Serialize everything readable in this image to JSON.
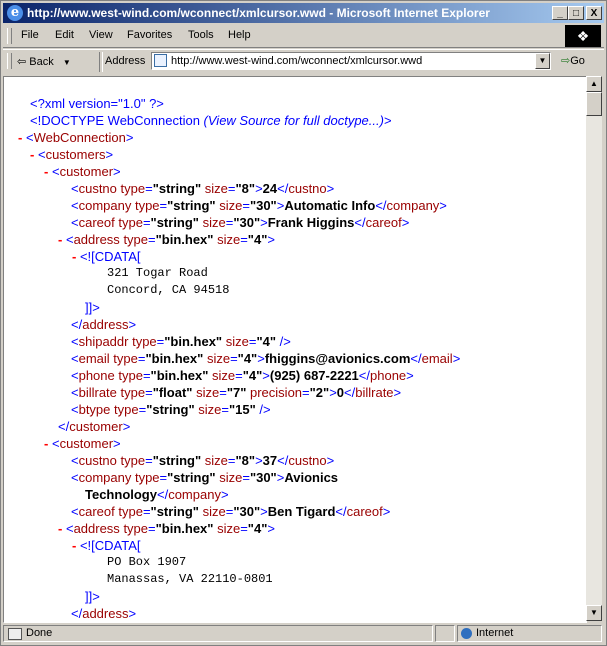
{
  "window": {
    "title": "http://www.west-wind.com/wconnect/xmlcursor.wwd - Microsoft Internet Explorer",
    "minimize": "_",
    "maximize": "□",
    "close": "X"
  },
  "menu": [
    "File",
    "Edit",
    "View",
    "Favorites",
    "Tools",
    "Help"
  ],
  "toolbar": {
    "back_label": "Back",
    "address_label": "Address",
    "address_value": "http://www.west-wind.com/wconnect/xmlcursor.wwd",
    "go_label": "Go"
  },
  "xml": {
    "pi": "<?xml version=\"1.0\" ?>",
    "doctype": "<!DOCTYPE WebConnection",
    "doctype_note": "(View Source for full doctype...)",
    "doctype_end": ">",
    "root": "WebConnection",
    "customers": "customers",
    "customer": "customer",
    "c1": {
      "custno": "24",
      "company": "Automatic Info",
      "careof": "Frank Higgins",
      "address_line1": "321 Togar Road",
      "address_line2": "Concord, CA 94518",
      "email": "fhiggins@avionics.com",
      "phone": "(925) 687-2221",
      "billrate": "0"
    },
    "c2": {
      "custno": "37",
      "company_a": "Avionics",
      "company_b": "Technology",
      "careof": "Ben Tigard",
      "address_line1": "PO Box 1907",
      "address_line2": "Manassas, VA 22110-0801"
    },
    "attrs": {
      "type": "type",
      "size": "size",
      "precision": "precision",
      "string": "\"string\"",
      "binhex": "\"bin.hex\"",
      "float": "\"float\"",
      "s8": "\"8\"",
      "s30": "\"30\"",
      "s4": "\"4\"",
      "s7": "\"7\"",
      "s15": "\"15\"",
      "p2": "\"2\""
    },
    "cdata_open": "<![CDATA[",
    "cdata_close": "]]>"
  },
  "status": {
    "text": "Done",
    "zone": "Internet"
  }
}
